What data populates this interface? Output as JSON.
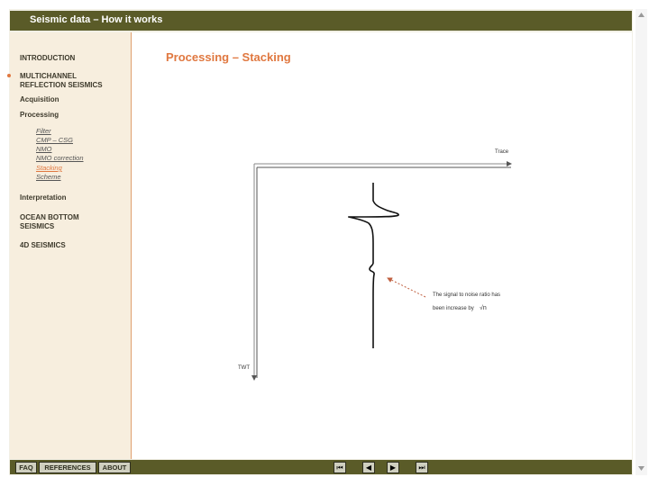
{
  "window": {
    "title": "Seismic data – How it works"
  },
  "sidebar": {
    "introduction": "INTRODUCTION",
    "multichannel_line1": "MULTICHANNEL",
    "multichannel_line2": "REFLECTION SEISMICS",
    "acquisition": "Acquisition",
    "processing": "Processing",
    "processing_items": [
      {
        "label": "Filter"
      },
      {
        "label": "CMP – CSG"
      },
      {
        "label": "NMO"
      },
      {
        "label": "NMO correction"
      },
      {
        "label": "Stacking"
      },
      {
        "label": "Scheme"
      }
    ],
    "interpretation": "Interpretation",
    "ocean_line1": "OCEAN BOTTOM",
    "ocean_line2": "SEISMICS",
    "fourd": "4D SEISMICS"
  },
  "main": {
    "heading": "Processing – Stacking",
    "diagram": {
      "x_axis_label": "Trace",
      "y_axis_label": "TWT",
      "annotation_line1": "The signal to noise ratio has",
      "annotation_line2": "been increase by",
      "annotation_formula": "√n"
    }
  },
  "footer": {
    "faq": "FAQ",
    "references": "REFERENCES",
    "about": "ABOUT",
    "nav_first": "⏮",
    "nav_prev": "◀",
    "nav_next": "▶",
    "nav_last": "⏭"
  },
  "colors": {
    "titlebar": "#5a5b28",
    "accent": "#e07840",
    "sidebar_bg": "#f7eede"
  }
}
